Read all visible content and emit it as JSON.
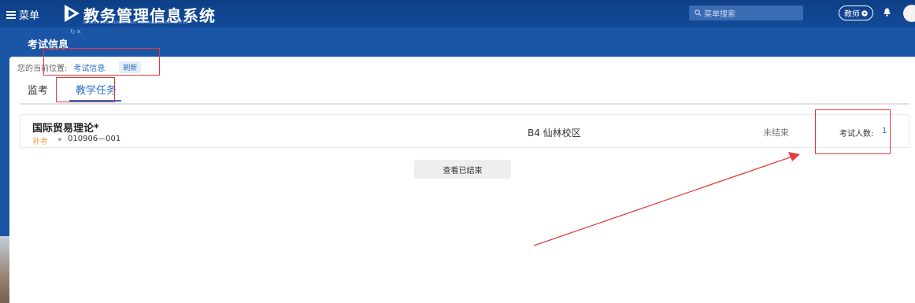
{
  "topbar": {
    "menu_label": "菜单",
    "app_title": "教务管理信息系统",
    "app_subtitle": "EDUCATIONAL ADMINISTRATION MANAGEMENT SYSTEM",
    "search_placeholder": "菜单搜索",
    "role_label": "教师"
  },
  "subheader": {
    "page_title": "考试信息"
  },
  "breadcrumb": {
    "prefix": "您的当前位置:",
    "current": "考试信息",
    "refresh_label": "刷新"
  },
  "tabs": [
    {
      "label": "监考",
      "active": false
    },
    {
      "label": "教学任务",
      "active": true
    }
  ],
  "exam_card": {
    "course_name": "国际贸易理论*",
    "badge": "补考",
    "course_code": "010906—001",
    "location": "B4 仙林校区",
    "status": "未结束",
    "count_label": "考试人数:",
    "count_value": "1"
  },
  "view_ended_label": "查看已结束",
  "colors": {
    "header_bg": "#124a98",
    "accent": "#2a6ec6",
    "badge": "#f5a04c",
    "annotation_red": "#e43a3a"
  }
}
